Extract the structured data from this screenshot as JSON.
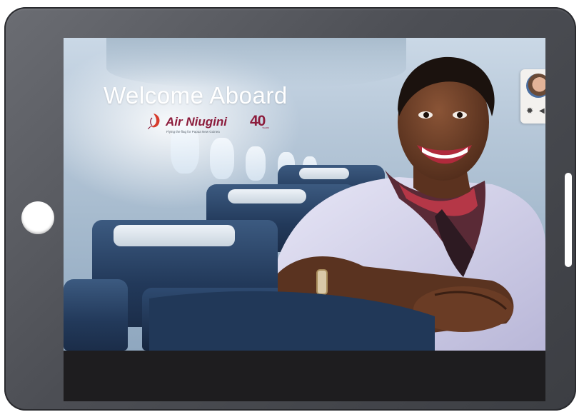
{
  "screen": {
    "welcome_text": "Welcome Aboard",
    "brand_name": "Air Niugini",
    "anniversary_number": "40",
    "anniversary_sub": "YEARS",
    "tagline": "Flying the flag for Papua New Guinea"
  },
  "colors": {
    "brand": "#8c1c3c",
    "device_frame": "#55575c",
    "bottom_bar": "#1e1d1f"
  },
  "icons": [
    "home-button",
    "avatar-icon",
    "lightbulb-icon",
    "nav-arrow-icon"
  ]
}
